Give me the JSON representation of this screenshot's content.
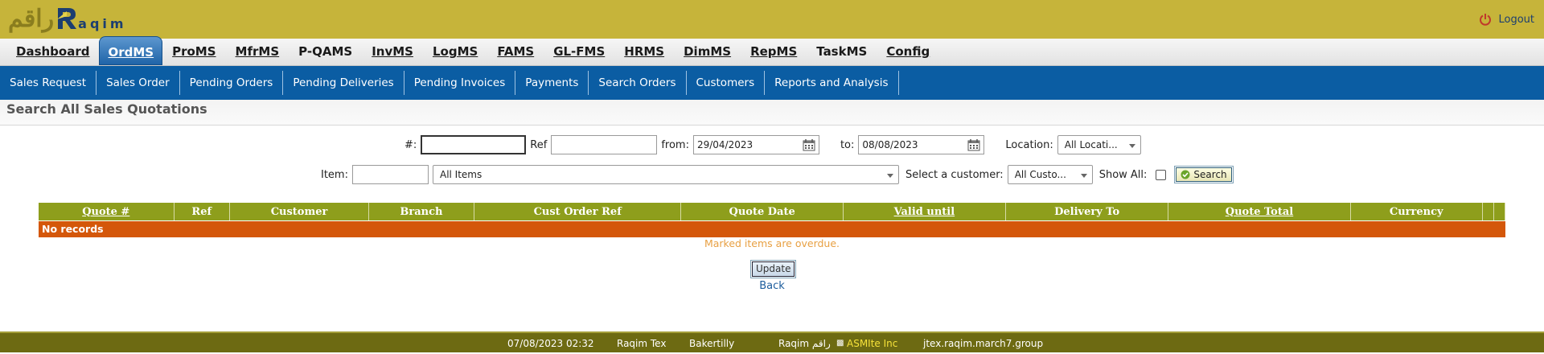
{
  "header": {
    "logo_arabic": "راقم",
    "logo_english": "aqim",
    "logout_label": "Logout"
  },
  "mainnav": [
    "Dashboard",
    "OrdMS",
    "ProMS",
    "MfrMS",
    "P-QAMS",
    "InvMS",
    "LogMS",
    "FAMS",
    "GL-FMS",
    "HRMS",
    "DimMS",
    "RepMS",
    "TaskMS",
    "Config"
  ],
  "subnav": [
    "Sales Request",
    "Sales Order",
    "Pending Orders",
    "Pending Deliveries",
    "Pending Invoices",
    "Payments",
    "Search Orders",
    "Customers",
    "Reports and Analysis"
  ],
  "page_title": "Search All Sales Quotations",
  "form": {
    "num_label": "#:",
    "ref_label": "Ref",
    "from_label": "from:",
    "from_value": "29/04/2023",
    "to_label": "to:",
    "to_value": "08/08/2023",
    "location_label": "Location:",
    "location_value": "All Locati...",
    "item_label": "Item:",
    "items_value": "All Items",
    "customer_label": "Select a customer:",
    "customer_value": "All Custo...",
    "show_all_label": "Show All:",
    "search_label": "Search"
  },
  "table": {
    "columns": [
      "Quote #",
      "Ref",
      "Customer",
      "Branch",
      "Cust Order Ref",
      "Quote Date",
      "Valid until",
      "Delivery To",
      "Quote Total",
      "Currency",
      "",
      ""
    ],
    "no_records": "No records"
  },
  "overdue_note": "Marked items are overdue.",
  "update_label": "Update",
  "back_label": "Back",
  "footer": {
    "datetime": "07/08/2023 02:32",
    "user": "Raqim Tex",
    "org": "Bakertilly",
    "brand": "Raqim راقم",
    "company": "ASMIte Inc",
    "host": "jtex.raqim.march7.group"
  },
  "colors": {
    "banner": "#c6b43a",
    "subnav": "#0b5da3",
    "table_header": "#8e9e1c",
    "no_records": "#d4570a",
    "footer": "#6d6a12"
  }
}
